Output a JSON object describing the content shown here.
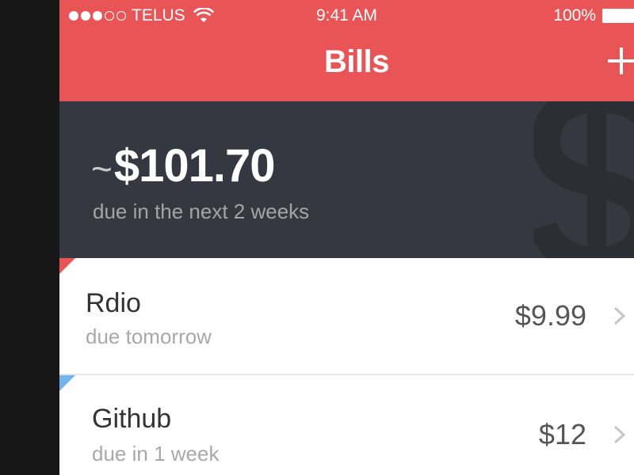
{
  "status_bar": {
    "signal_dots_filled": 3,
    "signal_dots_total": 5,
    "carrier": "TELUS",
    "time": "9:41 AM",
    "battery": "100%"
  },
  "nav": {
    "title": "Bills",
    "add_icon": "plus-icon"
  },
  "summary": {
    "prefix": "~",
    "total": "$101.70",
    "subtitle": "due in the next 2 weeks",
    "background_icon": "dollar-sign-icon"
  },
  "bills": [
    {
      "name": "Rdio",
      "due": "due tomorrow",
      "amount": "$9.99",
      "tag_color": "#e95556"
    },
    {
      "name": "Github",
      "due": "due in 1 week",
      "amount": "$12",
      "tag_color": "#71b6ea"
    }
  ],
  "colors": {
    "accent": "#e95556",
    "summary_bg": "#353840",
    "tag_blue": "#71b6ea"
  }
}
